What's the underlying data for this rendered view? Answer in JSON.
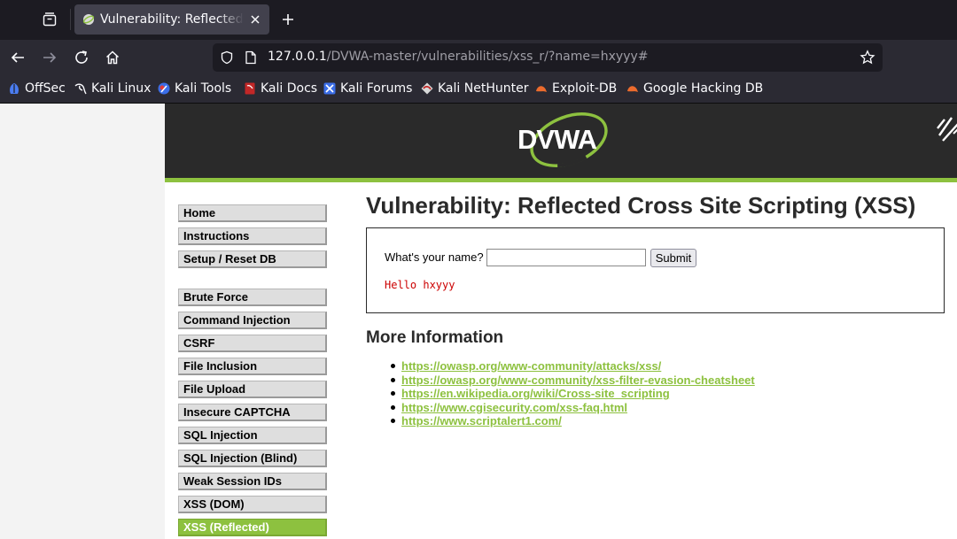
{
  "browser": {
    "tab": {
      "title": "Vulnerability: Reflected Cross Site Scripting (XSS)",
      "favicon": "dvwa-favicon-icon"
    },
    "url": {
      "host": "127.0.0.1",
      "path": "/DVWA-master/vulnerabilities/xss_r/?name=hxyyy#"
    },
    "bookmarks": [
      {
        "label": "OffSec",
        "icon": "offsec-icon"
      },
      {
        "label": "Kali Linux",
        "icon": "kali-dragon-icon"
      },
      {
        "label": "Kali Tools",
        "icon": "kali-tools-icon"
      },
      {
        "label": "Kali Docs",
        "icon": "kali-docs-icon"
      },
      {
        "label": "Kali Forums",
        "icon": "kali-forums-icon"
      },
      {
        "label": "Kali NetHunter",
        "icon": "kali-nethunter-icon"
      },
      {
        "label": "Exploit-DB",
        "icon": "exploit-db-icon"
      },
      {
        "label": "Google Hacking DB",
        "icon": "google-hacking-db-icon"
      }
    ]
  },
  "dvwa": {
    "logo_text": "DVWA",
    "menu": [
      {
        "label": "Home"
      },
      {
        "label": "Instructions"
      },
      {
        "label": "Setup / Reset DB"
      },
      {
        "label": "Brute Force"
      },
      {
        "label": "Command Injection"
      },
      {
        "label": "CSRF"
      },
      {
        "label": "File Inclusion"
      },
      {
        "label": "File Upload"
      },
      {
        "label": "Insecure CAPTCHA"
      },
      {
        "label": "SQL Injection"
      },
      {
        "label": "SQL Injection (Blind)"
      },
      {
        "label": "Weak Session IDs"
      },
      {
        "label": "XSS (DOM)"
      },
      {
        "label": "XSS (Reflected)",
        "active": true
      }
    ],
    "title": "Vulnerability: Reflected Cross Site Scripting (XSS)",
    "form": {
      "label": "What's your name?",
      "input_value": "",
      "submit_label": "Submit"
    },
    "result": "Hello hxyyy",
    "more_info": {
      "title": "More Information",
      "links": [
        "https://owasp.org/www-community/attacks/xss/",
        "https://owasp.org/www-community/xss-filter-evasion-cheatsheet",
        "https://en.wikipedia.org/wiki/Cross-site_scripting",
        "https://www.cgisecurity.com/xss-faq.html",
        "https://www.scriptalert1.com/"
      ]
    },
    "colors": {
      "accent": "#8dc13f",
      "header": "#2a2a2a",
      "result_text": "#cc0000"
    }
  }
}
